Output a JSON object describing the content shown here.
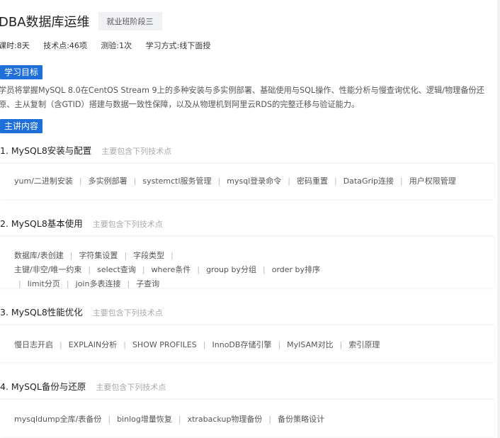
{
  "course": {
    "title": "DBA数据库运维",
    "stage_badge": "就业班阶段三",
    "meta": [
      "课时:8天",
      "技术点:46项",
      "测验:1次",
      "学习方式:线下面授"
    ]
  },
  "objective": {
    "label": "学习目标",
    "text": "学员将掌握MySQL 8.0在CentOS Stream 9上的多种安装与多实例部署、基础使用与SQL操作、性能分析与慢查询优化、逻辑/物理备份还原、主从复制（含GTID）搭建与数据一致性保障，以及从物理机到阿里云RDS的完整迁移与验证能力。"
  },
  "content": {
    "label": "主讲内容",
    "subtitle": "主要包含下列技术点",
    "modules": [
      {
        "title": "1. MySQL8安装与配置",
        "items": [
          "yum/二进制安装",
          "多实例部署",
          "systemctl服务管理",
          "mysql登录命令",
          "密码重置",
          "DataGrip连接",
          "用户权限管理"
        ]
      },
      {
        "title": "2. MySQL8基本使用",
        "items": [
          "数据库/表创建",
          "字符集设置",
          "字段类型",
          "主键/非空/唯一约束",
          "select查询",
          "where条件",
          "group by分组",
          "order by排序",
          "limit分页",
          "join多表连接",
          "子查询"
        ]
      },
      {
        "title": "3. MySQL8性能优化",
        "items": [
          "慢日志开启",
          "EXPLAIN分析",
          "SHOW PROFILES",
          "InnoDB存储引擎",
          "MyISAM对比",
          "索引原理"
        ]
      },
      {
        "title": "4. MySQL备份与还原",
        "items": [
          "mysqldump全库/表备份",
          "binlog增量恢复",
          "xtrabackup物理备份",
          "备份策略设计"
        ]
      }
    ]
  }
}
